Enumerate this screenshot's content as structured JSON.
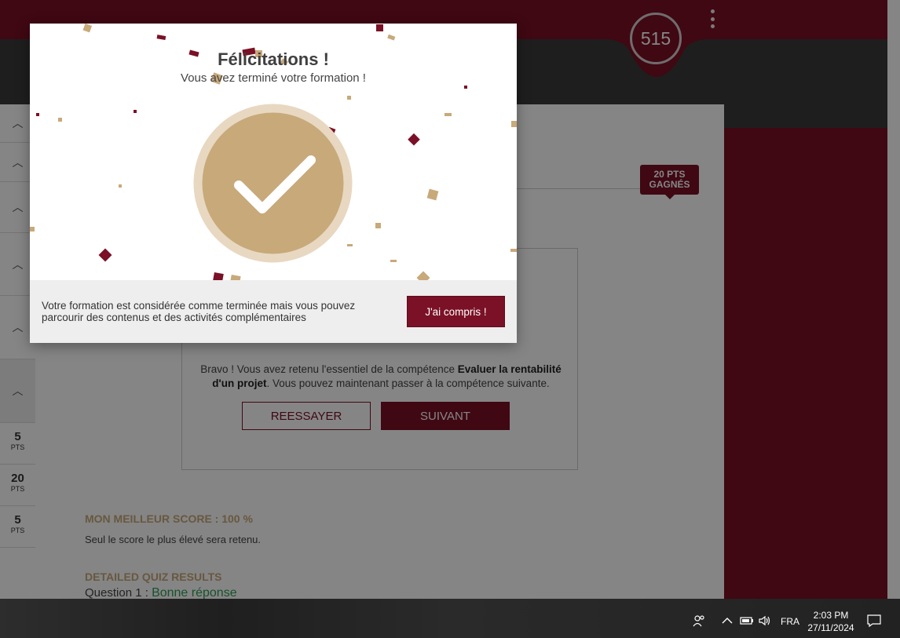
{
  "app": {
    "score": "515",
    "points_tag": [
      "20 PTS",
      "GAGNÉS"
    ],
    "sidebar_points": [
      {
        "value": "5",
        "unit": "PTS"
      },
      {
        "value": "20",
        "unit": "PTS"
      },
      {
        "value": "5",
        "unit": "PTS"
      }
    ],
    "result": {
      "text_before": "Bravo ! Vous avez retenu l'essentiel de la compétence ",
      "competence": "Evaluer la rentabilité d'un projet",
      "text_after": ". Vous pouvez maintenant passer à la compétence suivante.",
      "retry_label": "REESSAYER",
      "next_label": "SUIVANT"
    },
    "best_score": "MON MEILLEUR SCORE : 100 %",
    "best_score_note": "Seul le score le plus élevé sera retenu.",
    "detail_title": "DETAILED QUIZ RESULTS",
    "question_label": "Question 1 : ",
    "question_result": "Bonne réponse"
  },
  "modal": {
    "title": "Félicitations !",
    "subtitle": "Vous avez terminé votre formation !",
    "footer_text": "Votre formation est considérée comme terminée mais vous pouvez parcourir des contenus et des activités complémentaires",
    "confirm_label": "J'ai compris !"
  },
  "taskbar": {
    "language": "FRA",
    "time": "2:03 PM",
    "date": "27/11/2024",
    "icons": [
      "people-icon",
      "chevron-up-icon",
      "battery-icon",
      "volume-icon",
      "notification-icon"
    ]
  },
  "colors": {
    "brand": "#7a1126",
    "gold": "#c8a97a",
    "success": "#2f9e57"
  }
}
